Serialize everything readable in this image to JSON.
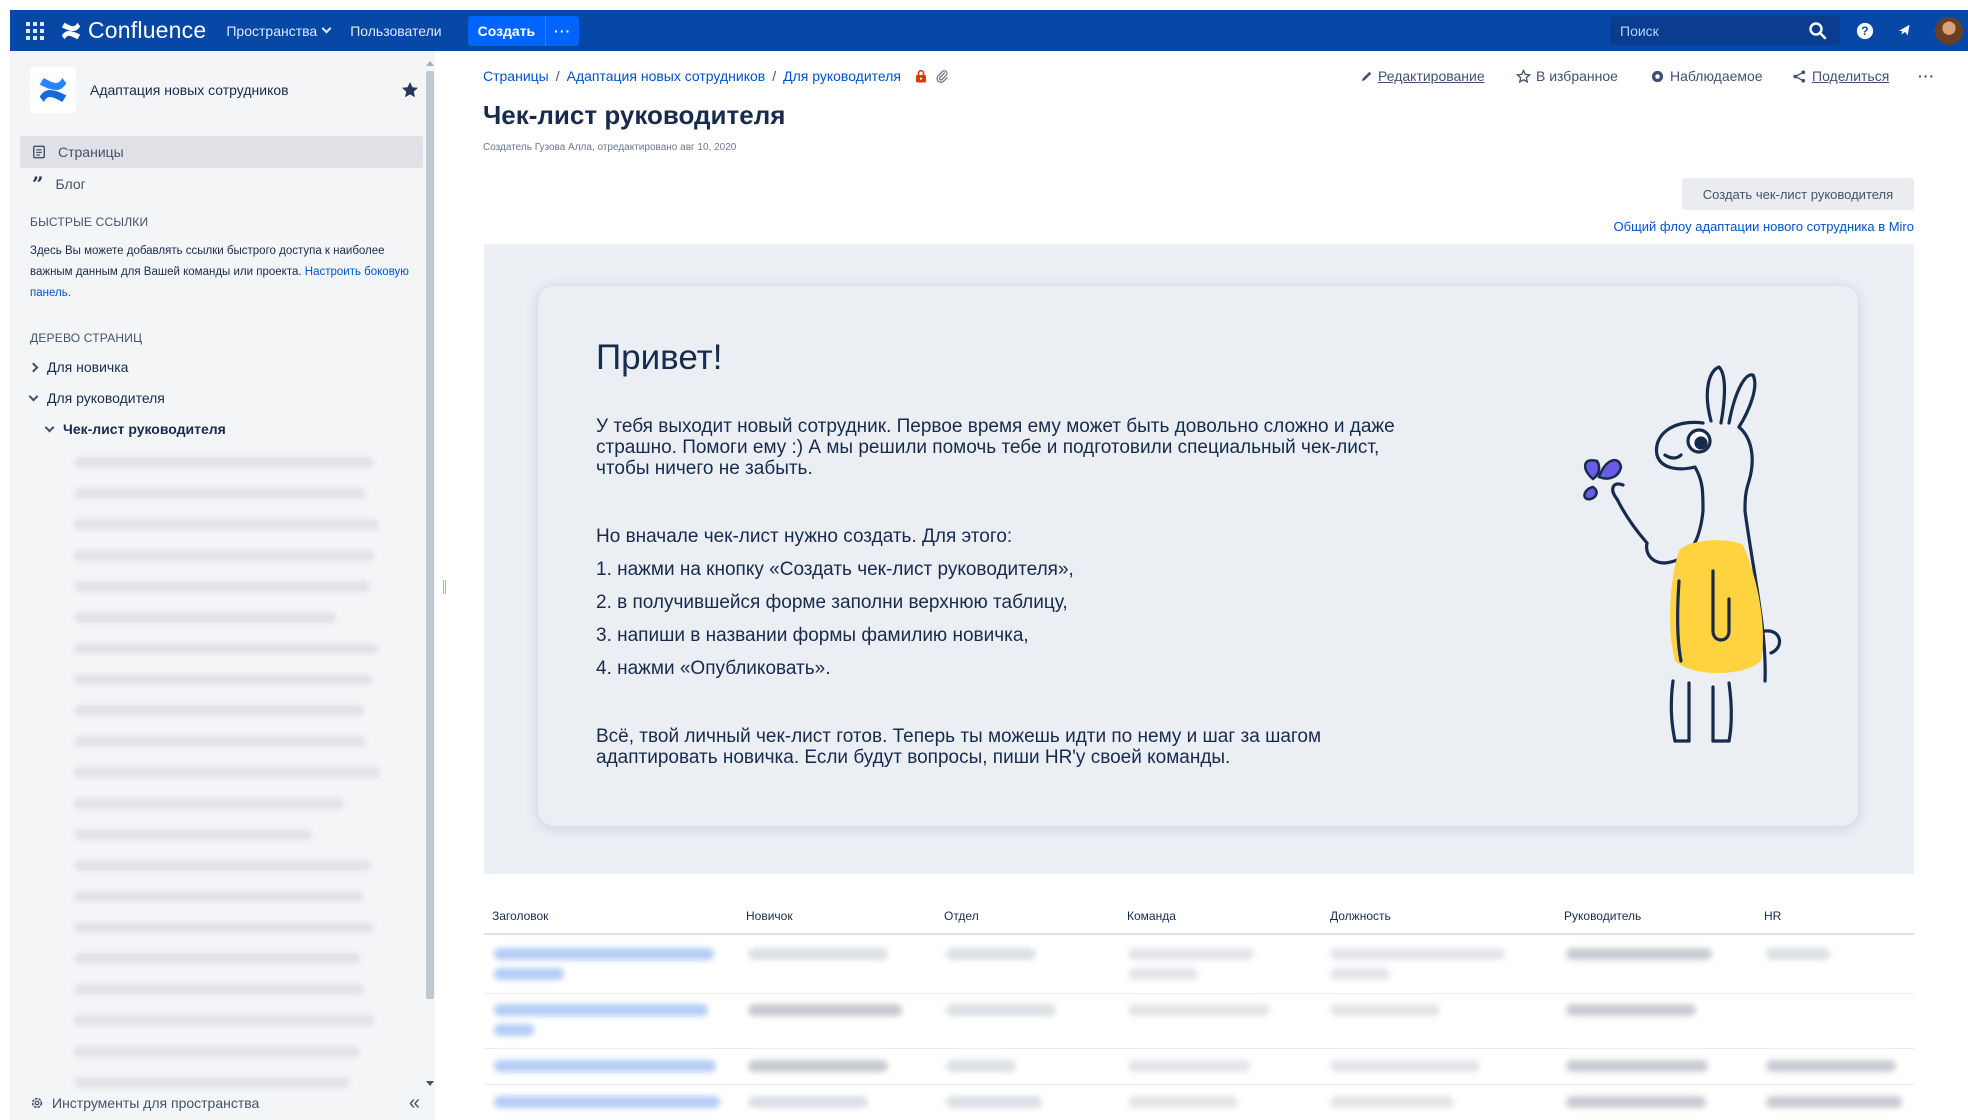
{
  "topnav": {
    "logo_text": "Confluence",
    "spaces_label": "Пространства",
    "users_label": "Пользователи",
    "create_label": "Создать",
    "more_label": "···",
    "search_placeholder": "Поиск"
  },
  "sidebar": {
    "space_name": "Адаптация новых сотрудников",
    "pages_label": "Страницы",
    "blog_label": "Блог",
    "quick_links_heading": "БЫСТРЫЕ ССЫЛКИ",
    "quick_links_text": "Здесь Вы можете добавлять ссылки быстрого доступа к наиболее важным данным для Вашей команды или проекта.",
    "configure_link": "Настроить боковую панель.",
    "tree_heading": "ДЕРЕВО СТРАНИЦ",
    "tree": [
      "Для новичка",
      "Для руководителя",
      "Чек-лист руководителя"
    ],
    "tools_label": "Инструменты для пространства",
    "collapse_label": "«"
  },
  "breadcrumb": [
    "Страницы",
    "Адаптация новых сотрудников",
    "Для руководителя"
  ],
  "actions": {
    "edit": "Редактирование",
    "favorite": "В избранное",
    "watch": "Наблюдаемое",
    "share": "Поделиться",
    "more": "···"
  },
  "page": {
    "title": "Чек-лист руководителя",
    "byline": "Создатель Гузова Алла, отредактировано авг 10, 2020",
    "create_button": "Создать чек-лист руководителя",
    "miro_link": "Общий флоу адаптации нового сотрудника в Miro"
  },
  "banner": {
    "greeting": "Привет!",
    "intro": "У тебя выходит новый сотрудник. Первое время ему может быть довольно сложно и даже страшно. Помоги ему :) А мы решили помочь тебе и подготовили специальный чек-лист, чтобы ничего не забыть.",
    "steps_intro": "Но вначале чек-лист нужно создать. Для этого:",
    "steps": [
      "1. нажми на кнопку «Создать чек-лист руководителя»,",
      "2. в получившейся форме заполни верхнюю таблицу,",
      "3. напиши в названии формы фамилию новичка,",
      "4. нажми «Опубликовать»."
    ],
    "outro": "Всё, твой личный чек-лист готов. Теперь ты можешь идти по нему и шаг за шагом адаптировать новичка. Если будут вопросы, пиши HR'у своей команды."
  },
  "table": {
    "columns": [
      "Заголовок",
      "Новичок",
      "Отдел",
      "Команда",
      "Должность",
      "Руководитель",
      "HR"
    ]
  },
  "colors": {
    "nav_bg": "#0747a6",
    "create_btn": "#0065ff",
    "link": "#0052cc",
    "sidebar_bg": "#f4f5f7",
    "banner_bg": "#eceff4",
    "llama_yellow": "#ffd23f",
    "butterfly": "#6b5ce7"
  }
}
